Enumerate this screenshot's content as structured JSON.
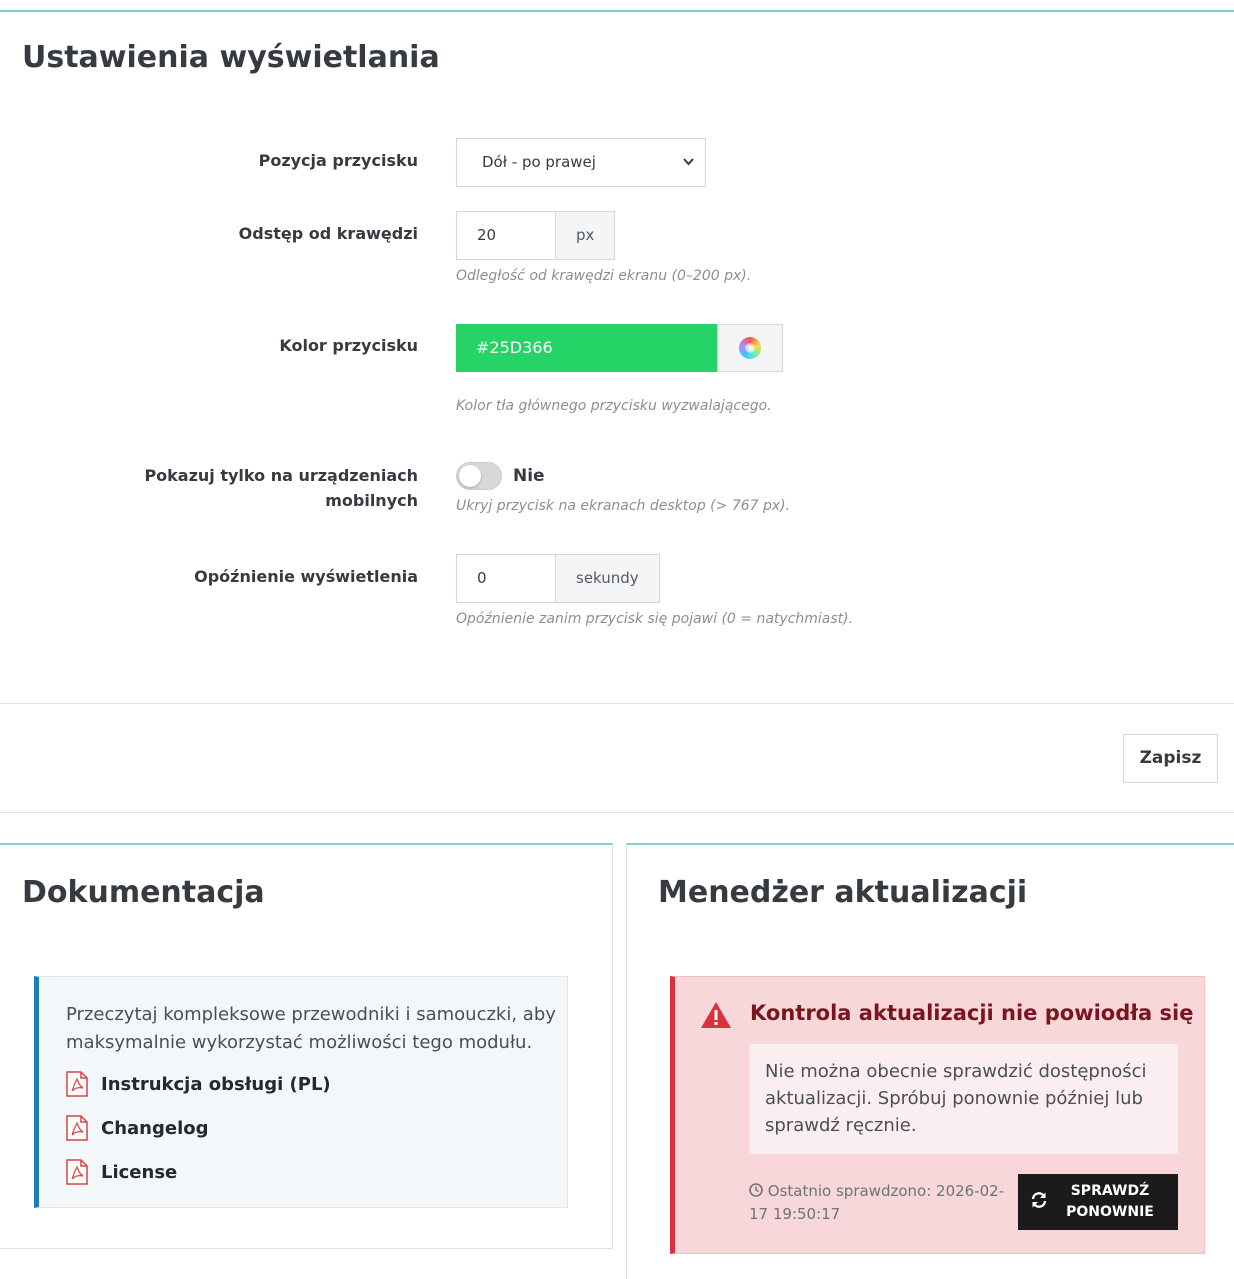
{
  "settings": {
    "title": "Ustawienia wyświetlania",
    "position": {
      "label": "Pozycja przycisku",
      "value": "Dół - po prawej"
    },
    "offset": {
      "label": "Odstęp od krawędzi",
      "value": "20",
      "unit": "px",
      "help": "Odległość od krawędzi ekranu (0–200 px)."
    },
    "color": {
      "label": "Kolor przycisku",
      "value": "#25D366",
      "help": "Kolor tła głównego przycisku wyzwalającego."
    },
    "mobile_only": {
      "label_line1": "Pokazuj tylko na urządzeniach",
      "label_line2": "mobilnych",
      "state": "Nie",
      "help": "Ukryj przycisk na ekranach desktop (> 767 px)."
    },
    "delay": {
      "label": "Opóźnienie wyświetlenia",
      "value": "0",
      "unit": "sekundy",
      "help": "Opóźnienie zanim przycisk się pojawi (0 = natychmiast)."
    },
    "save_label": "Zapisz"
  },
  "documentation": {
    "title": "Dokumentacja",
    "intro": "Przeczytaj kompleksowe przewodniki i samouczki, aby maksymalnie wykorzystać możliwości tego modułu.",
    "links": [
      "Instrukcja obsługi (PL)",
      "Changelog",
      "License"
    ]
  },
  "updates": {
    "title": "Menedżer aktualizacji",
    "alert_title": "Kontrola aktualizacji nie powiodła się",
    "alert_message": "Nie można obecnie sprawdzić dostępności aktualizacji. Spróbuj ponownie później lub sprawdź ręcznie.",
    "last_checked_label": "Ostatnio sprawdzono:",
    "last_checked_value": "2026-02-17 19:50:17",
    "retry_label_line1": "SPRAWDŹ",
    "retry_label_line2": "PONOWNIE"
  },
  "colors": {
    "accent_border": "#7fcfd3",
    "info_border": "#1d7fb8",
    "danger_border": "#d9323f",
    "swatch": "#25D366"
  }
}
